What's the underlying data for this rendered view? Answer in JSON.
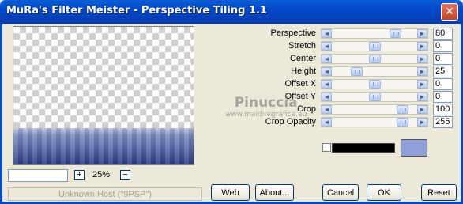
{
  "window": {
    "title": "MuRa's Filter Meister - Perspective Tiling 1.1",
    "close_icon": "close-icon"
  },
  "zoom": {
    "value": "",
    "plus": "+",
    "minus": "−",
    "percent": "25%"
  },
  "status": {
    "text": "Unknown Host (\"9PSP\")"
  },
  "params": [
    {
      "label": "Perspective",
      "value": "80",
      "thumb_fraction": 0.79
    },
    {
      "label": "Stretch",
      "value": "0",
      "thumb_fraction": 0.5
    },
    {
      "label": "Center",
      "value": "0",
      "thumb_fraction": 0.5
    },
    {
      "label": "Height",
      "value": "25",
      "thumb_fraction": 0.25
    },
    {
      "label": "Offset X",
      "value": "0",
      "thumb_fraction": 0.5
    },
    {
      "label": "Offset Y",
      "value": "0",
      "thumb_fraction": 0.5
    },
    {
      "label": "Crop",
      "value": "100",
      "thumb_fraction": 0.89
    },
    {
      "label": "Crop Opacity",
      "value": "255",
      "thumb_fraction": 0.89
    }
  ],
  "arrows": {
    "left": "◄",
    "right": "►"
  },
  "watermark": {
    "name": "Pinuccia",
    "site": "www.maidiregrafica.eu"
  },
  "colors": {
    "swatch": "#8e9fdb",
    "black_bar": "#000000",
    "small_box": "#ffffff"
  },
  "buttons": {
    "web": "Web",
    "about": "About...",
    "cancel": "Cancel",
    "ok": "OK",
    "reset": "Reset"
  }
}
